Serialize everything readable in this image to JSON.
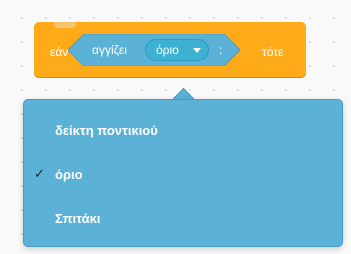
{
  "block": {
    "if_label": "εάν",
    "then_label": "τότε",
    "touching_label": "αγγίζει",
    "separator": ":"
  },
  "dropdown": {
    "selected": "όριο",
    "caret_icon": "caret-down-icon"
  },
  "menu": {
    "items": [
      {
        "label": "δείκτη ποντικιού",
        "selected": false
      },
      {
        "label": "όριο",
        "selected": true,
        "check": "✓"
      },
      {
        "label": "Σπιτάκι",
        "selected": false
      }
    ]
  },
  "colors": {
    "control_block": "#ffab19",
    "sensing_block": "#5cb1d6",
    "dropdown_pill": "#3eb1d3",
    "menu_background": "#5cb1d6"
  }
}
